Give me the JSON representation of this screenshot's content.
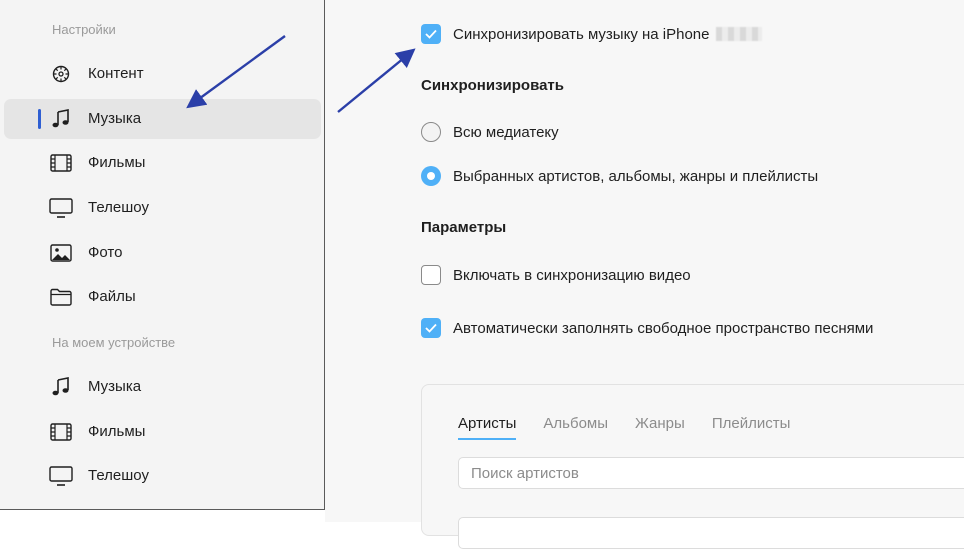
{
  "sidebar": {
    "section_settings": "Настройки",
    "settings_items": [
      {
        "label": "Контент",
        "icon": "gear-icon"
      },
      {
        "label": "Музыка",
        "icon": "music-note-icon",
        "selected": true
      },
      {
        "label": "Фильмы",
        "icon": "film-icon"
      },
      {
        "label": "Телешоу",
        "icon": "tv-icon"
      },
      {
        "label": "Фото",
        "icon": "photo-icon"
      },
      {
        "label": "Файлы",
        "icon": "folder-icon"
      }
    ],
    "section_device": "На моем устройстве",
    "device_items": [
      {
        "label": "Музыка",
        "icon": "music-note-icon"
      },
      {
        "label": "Фильмы",
        "icon": "film-icon"
      },
      {
        "label": "Телешоу",
        "icon": "tv-icon"
      }
    ]
  },
  "main": {
    "sync_music_label": "Синхронизировать музыку на iPhone",
    "sync_music_checked": true,
    "sync_heading": "Синхронизировать",
    "radio_all_label": "Всю медиатеку",
    "radio_selected_label": "Выбранных артистов, альбомы, жанры и плейлисты",
    "selected_option": "radio_selected",
    "params_heading": "Параметры",
    "include_video_label": "Включать в синхронизацию видео",
    "include_video_checked": false,
    "autofill_label": "Автоматически заполнять свободное пространство песнями",
    "autofill_checked": true,
    "tabs": [
      {
        "label": "Артисты",
        "active": true
      },
      {
        "label": "Альбомы"
      },
      {
        "label": "Жанры"
      },
      {
        "label": "Плейлисты"
      }
    ],
    "search_placeholder": "Поиск артистов"
  },
  "colors": {
    "accent": "#4fb0f7",
    "selection_bar": "#2f5fd2",
    "annotation_arrow": "#2b3fa8"
  }
}
